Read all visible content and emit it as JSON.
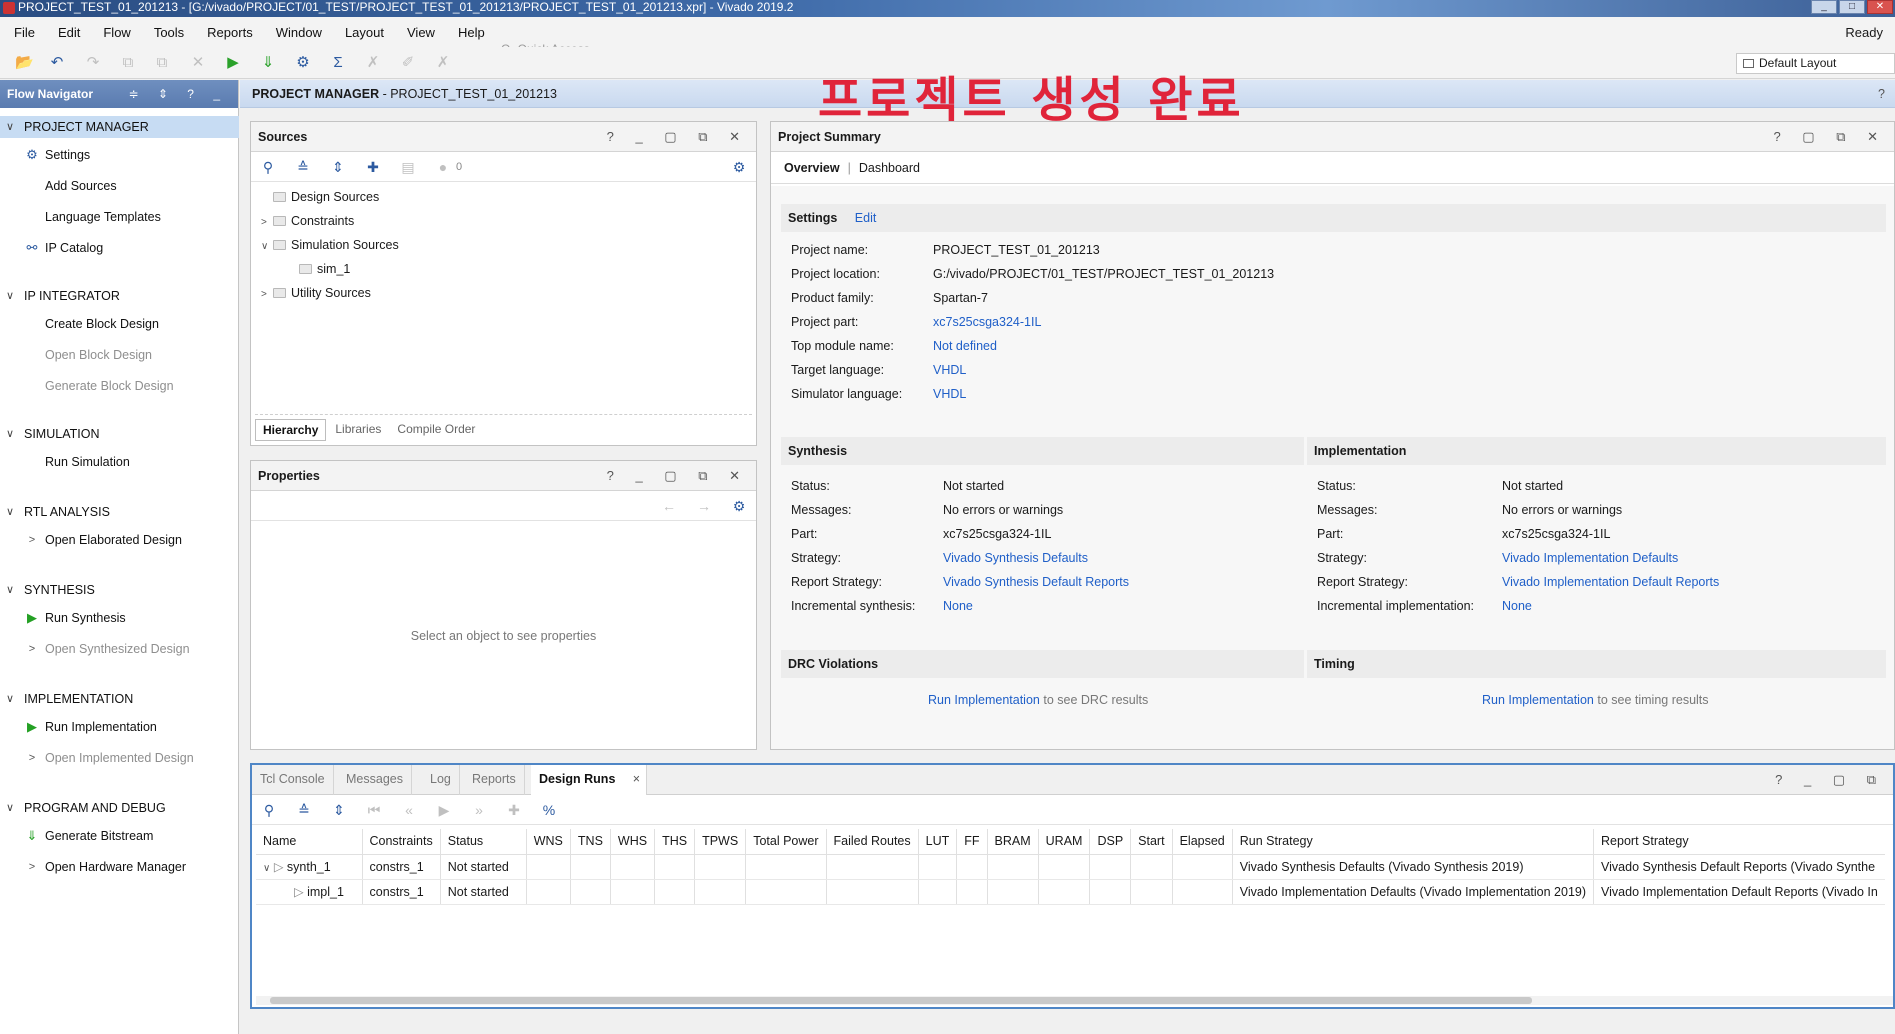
{
  "window": {
    "title": "PROJECT_TEST_01_201213 - [G:/vivado/PROJECT/01_TEST/PROJECT_TEST_01_201213/PROJECT_TEST_01_201213.xpr] - Vivado 2019.2",
    "controls": [
      "_",
      "□",
      "✕"
    ]
  },
  "menu": {
    "items": [
      "File",
      "Edit",
      "Flow",
      "Tools",
      "Reports",
      "Window",
      "Layout",
      "View",
      "Help"
    ],
    "quick_access_placeholder": "Q- Quick Access",
    "status": "Ready"
  },
  "toolbar": {
    "layout_label": "Default Layout"
  },
  "overlay_title": "프로젝트 생성 완료",
  "flow_navigator": {
    "title": "Flow Navigator",
    "header_icons": "≑ ⇕ ? _",
    "sections": [
      {
        "label": "PROJECT MANAGER",
        "items": [
          "Settings",
          "Add Sources",
          "Language Templates",
          "IP Catalog"
        ]
      },
      {
        "label": "IP INTEGRATOR",
        "items": [
          "Create Block Design",
          "Open Block Design",
          "Generate Block Design"
        ]
      },
      {
        "label": "SIMULATION",
        "items": [
          "Run Simulation"
        ]
      },
      {
        "label": "RTL ANALYSIS",
        "items": [
          "Open Elaborated Design"
        ]
      },
      {
        "label": "SYNTHESIS",
        "items": [
          "Run Synthesis",
          "Open Synthesized Design"
        ]
      },
      {
        "label": "IMPLEMENTATION",
        "items": [
          "Run Implementation",
          "Open Implemented Design"
        ]
      },
      {
        "label": "PROGRAM AND DEBUG",
        "items": [
          "Generate Bitstream",
          "Open Hardware Manager"
        ]
      }
    ]
  },
  "project_manager": {
    "prefix": "PROJECT MANAGER",
    "name": " - PROJECT_TEST_01_201213",
    "help": "?"
  },
  "sources": {
    "title": "Sources",
    "controls": "? _ ▢ ⧉ ✕",
    "count": "0",
    "tree": [
      "Design Sources",
      "Constraints",
      "Simulation Sources",
      "sim_1",
      "Utility Sources"
    ],
    "tabs": [
      "Hierarchy",
      "Libraries",
      "Compile Order"
    ]
  },
  "properties": {
    "title": "Properties",
    "controls": "? _ ▢ ⧉ ✕",
    "empty_message": "Select an object to see properties"
  },
  "summary": {
    "title": "Project Summary",
    "controls": "? ▢ ⧉ ✕",
    "tabs": [
      "Overview",
      "Dashboard"
    ],
    "settings": {
      "title": "Settings",
      "edit": "Edit",
      "rows": [
        {
          "key": "Project name:",
          "value": "PROJECT_TEST_01_201213"
        },
        {
          "key": "Project location:",
          "value": "G:/vivado/PROJECT/01_TEST/PROJECT_TEST_01_201213"
        },
        {
          "key": "Product family:",
          "value": "Spartan-7"
        },
        {
          "key": "Project part:",
          "value": "xc7s25csga324-1IL"
        },
        {
          "key": "Top module name:",
          "value": "Not defined"
        },
        {
          "key": "Target language:",
          "value": "VHDL"
        },
        {
          "key": "Simulator language:",
          "value": "VHDL"
        }
      ]
    },
    "synthesis": {
      "title": "Synthesis",
      "rows": [
        {
          "key": "Status:",
          "value": "Not started"
        },
        {
          "key": "Messages:",
          "value": "No errors or warnings"
        },
        {
          "key": "Part:",
          "value": "xc7s25csga324-1IL"
        },
        {
          "key": "Strategy:",
          "value": "Vivado Synthesis Defaults"
        },
        {
          "key": "Report Strategy:",
          "value": "Vivado Synthesis Default Reports"
        },
        {
          "key": "Incremental synthesis:",
          "value": "None"
        }
      ]
    },
    "implementation": {
      "title": "Implementation",
      "rows": [
        {
          "key": "Status:",
          "value": "Not started"
        },
        {
          "key": "Messages:",
          "value": "No errors or warnings"
        },
        {
          "key": "Part:",
          "value": "xc7s25csga324-1IL"
        },
        {
          "key": "Strategy:",
          "value": "Vivado Implementation Defaults"
        },
        {
          "key": "Report Strategy:",
          "value": "Vivado Implementation Default Reports"
        },
        {
          "key": "Incremental implementation:",
          "value": "None"
        }
      ]
    },
    "drc": {
      "title": "DRC Violations",
      "link": "Run Implementation",
      "text": "to see DRC results"
    },
    "timing": {
      "title": "Timing",
      "link": "Run Implementation",
      "text": "to see timing results"
    }
  },
  "bottom": {
    "tabs": [
      "Tcl Console",
      "Messages",
      "Log",
      "Reports",
      "Design Runs"
    ],
    "close": "×",
    "controls": "? _ ▢ ⧉",
    "columns": [
      "Name",
      "Constraints",
      "Status",
      "WNS",
      "TNS",
      "WHS",
      "THS",
      "TPWS",
      "Total Power",
      "Failed Routes",
      "LUT",
      "FF",
      "BRAM",
      "URAM",
      "DSP",
      "Start",
      "Elapsed",
      "Run Strategy",
      "Report Strategy"
    ],
    "rows": [
      {
        "name": "synth_1",
        "constraints": "constrs_1",
        "status": "Not started",
        "run_strategy": "Vivado Synthesis Defaults (Vivado Synthesis 2019)",
        "report_strategy": "Vivado Synthesis Default Reports (Vivado Synthe"
      },
      {
        "name": "impl_1",
        "constraints": "constrs_1",
        "status": "Not started",
        "run_strategy": "Vivado Implementation Defaults (Vivado Implementation 2019)",
        "report_strategy": "Vivado Implementation Default Reports (Vivado In"
      }
    ]
  }
}
